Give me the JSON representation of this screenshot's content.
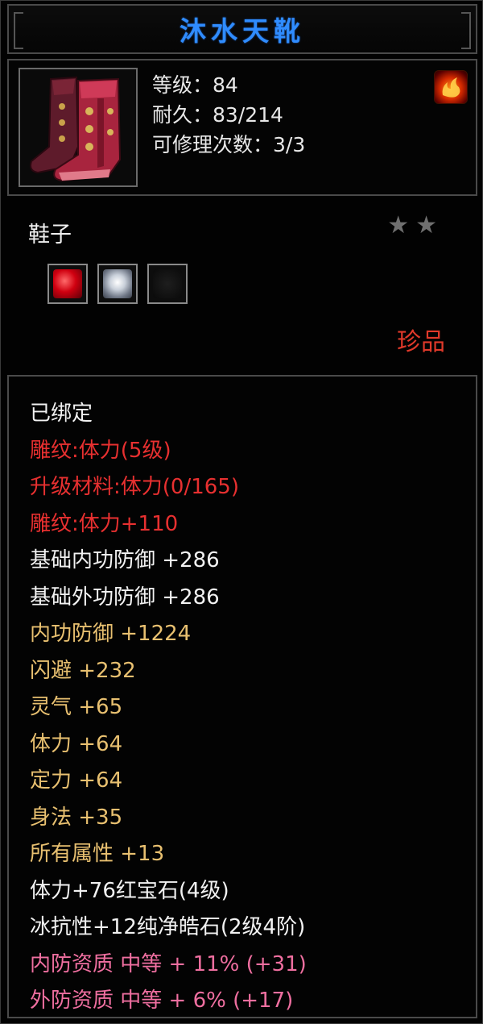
{
  "item": {
    "name": "沐水天靴",
    "level_line": "等级：84",
    "durability_line": "耐久：83/214",
    "repairs_line": "可修理次数：3/3",
    "type": "鞋子",
    "stars": 2,
    "rarity": "珍品",
    "element_icon": "fire-icon"
  },
  "gems": [
    {
      "name": "ruby-gem-icon",
      "color": "#d00010"
    },
    {
      "name": "diamond-gem-icon",
      "color": "#c9d0da"
    },
    {
      "name": "empty-socket-icon",
      "color": "#0a0a0a"
    }
  ],
  "attributes": [
    {
      "text": "已绑定",
      "color": "white"
    },
    {
      "text": "雕纹:体力(5级)",
      "color": "red"
    },
    {
      "text": "升级材料:体力(0/165)",
      "color": "red"
    },
    {
      "text": "雕纹:体力+110",
      "color": "red"
    },
    {
      "text": "基础内功防御 +286",
      "color": "white"
    },
    {
      "text": "基础外功防御 +286",
      "color": "white"
    },
    {
      "text": "内功防御 +1224",
      "color": "gold"
    },
    {
      "text": "闪避 +232",
      "color": "gold"
    },
    {
      "text": "灵气 +65",
      "color": "gold"
    },
    {
      "text": "体力 +64",
      "color": "gold"
    },
    {
      "text": "定力 +64",
      "color": "gold"
    },
    {
      "text": "身法 +35",
      "color": "gold"
    },
    {
      "text": "所有属性 +13",
      "color": "gold"
    },
    {
      "text": "体力+76红宝石(4级)",
      "color": "white"
    },
    {
      "text": "冰抗性+12纯净皓石(2级4阶)",
      "color": "white"
    },
    {
      "text": "内防资质 中等 + 11% (+31)",
      "color": "pink"
    },
    {
      "text": "外防资质 中等 + 6% (+17)",
      "color": "pink"
    }
  ],
  "colors": {
    "title_blue": "#2f8cff",
    "red": "#e83030",
    "gold": "#e8c070",
    "pink": "#ef6fa0",
    "white": "#f2f2f2"
  }
}
